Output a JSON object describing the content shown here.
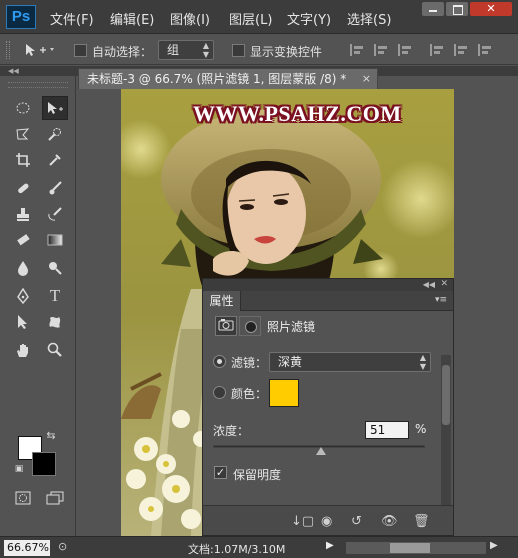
{
  "app": {
    "logo": "Ps"
  },
  "menu": [
    "文件(F)",
    "编辑(E)",
    "图像(I)",
    "图层(L)",
    "文字(Y)",
    "选择(S)"
  ],
  "window_controls": {
    "close": "✕"
  },
  "options_bar": {
    "auto_select_label": "自动选择：",
    "auto_select_value": "组",
    "show_transform_label": "显示变换控件"
  },
  "document": {
    "tab_title": "未标题-3 @ 66.7% (照片滤镜 1, 图层蒙版 /8) *",
    "close": "×",
    "watermark": "WWW.PSAHZ.COM"
  },
  "properties": {
    "tab": "属性",
    "adjustment_title": "照片滤镜",
    "filter_label": "滤镜：",
    "filter_value": "深黄",
    "color_label": "颜色：",
    "color_value": "#ffcc00",
    "density_label": "浓度：",
    "density_value": "51",
    "density_unit": "%",
    "density_fraction": 0.51,
    "preserve_luminosity_label": "保留明度",
    "preserve_luminosity_checked": true
  },
  "status": {
    "zoom": "66.67%",
    "doc_info": "文档:1.07M/3.10M"
  },
  "colors": {
    "foreground": "#ffffff",
    "background": "#000000",
    "watermark_outline": "#7a1020"
  }
}
